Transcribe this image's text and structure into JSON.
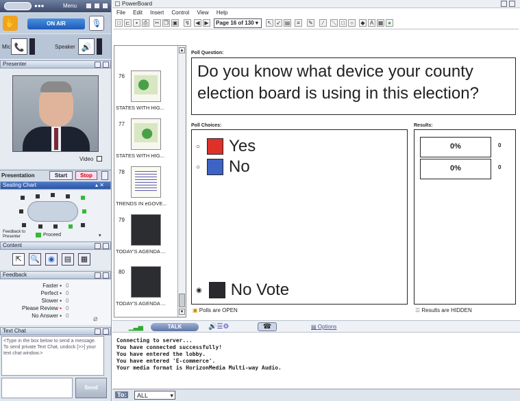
{
  "left": {
    "menu_label": "Menu",
    "on_air": "ON AIR",
    "mic_label": "Mic",
    "speaker_label": "Speaker",
    "presenter_title": "Presenter",
    "video_label": "Video",
    "presentation_label": "Presentation",
    "start_label": "Start",
    "stop_label": "Stop",
    "seating_chart": "Seating Chart",
    "feedback_to": "Feedback to Presenter",
    "proceed": "Proceed",
    "content_title": "Content",
    "feedback_title": "Feedback",
    "feedback_items": [
      {
        "label": "Faster",
        "count": "0"
      },
      {
        "label": "Perfect",
        "count": "0"
      },
      {
        "label": "Slower",
        "count": "0"
      },
      {
        "label": "Please Review",
        "count": "0"
      },
      {
        "label": "No Answer",
        "count": "0"
      }
    ],
    "text_chat_title": "Text Chat",
    "text_chat_hint": "<Type in the box below to send a message. To send private Text Chat, undock [>>] your text chat window.>",
    "send_label": "Send"
  },
  "app": {
    "title": "PowerBoard",
    "menu": [
      "File",
      "Edit",
      "Insert",
      "Control",
      "View",
      "Help"
    ],
    "page_indicator": "Page 16 of 130"
  },
  "thumbs": [
    {
      "num": "76",
      "caption": "STATES WITH HIG..."
    },
    {
      "num": "77",
      "caption": "STATES WITH HIG..."
    },
    {
      "num": "78",
      "caption": "TRENDS IN eGOVE..."
    },
    {
      "num": "79",
      "caption": "TODAY'S AGENDA ..."
    },
    {
      "num": "80",
      "caption": "TODAY'S AGENDA ..."
    }
  ],
  "poll": {
    "question_label": "Poll Question:",
    "question": "Do you know what device your county election board is using in this election?",
    "choices_label": "Poll Choices:",
    "results_label": "Results:",
    "choices": [
      {
        "label": "Yes",
        "color": "#e0302a",
        "result": "0%",
        "count": "0"
      },
      {
        "label": "No",
        "color": "#3d63c4",
        "result": "0%",
        "count": "0"
      }
    ],
    "no_vote": "No Vote",
    "no_vote_color": "#2a2a2e",
    "polls_open": "Polls are OPEN",
    "results_hidden": "Results are HIDDEN"
  },
  "audio_bar": {
    "talk": "TALK",
    "options": "Options"
  },
  "chat": {
    "lines": [
      "Connecting to server...",
      "You have connected successfully!",
      "",
      "You have entered the lobby.",
      "",
      "You have entered 'E-commerce'.",
      "Your media format is HorizonMedia Multi-way Audio."
    ],
    "to_label": "To:",
    "to_value": "ALL"
  }
}
